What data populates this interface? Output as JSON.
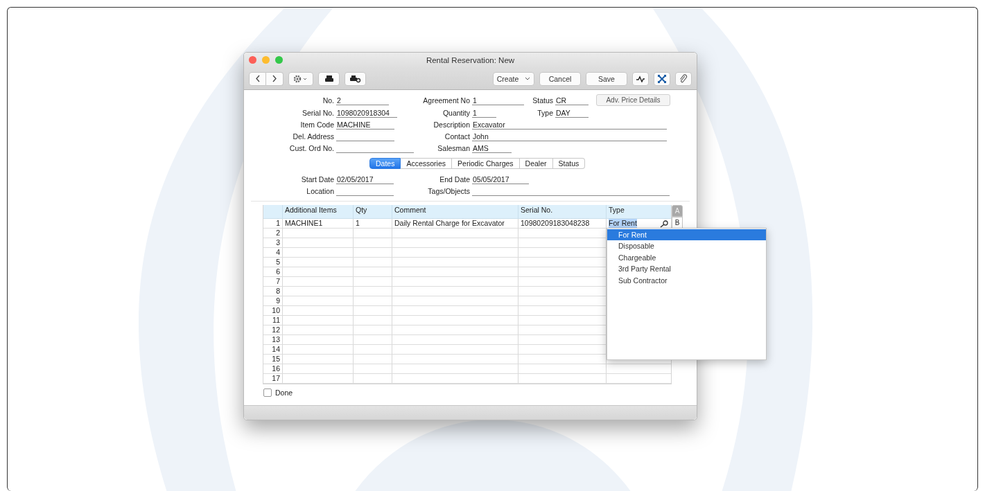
{
  "window": {
    "title": "Rental Reservation: New"
  },
  "toolbar": {
    "buttons": [
      {
        "kind": "create",
        "label": "Create"
      },
      {
        "kind": "plain",
        "label": "Cancel"
      },
      {
        "kind": "plain",
        "label": "Save"
      }
    ]
  },
  "form": {
    "rows": [
      [
        {
          "label": "No.",
          "value": "2"
        },
        {
          "label": "Agreement No",
          "value": "1"
        },
        {
          "label": "Status",
          "value": "CR"
        }
      ],
      [
        {
          "label": "Serial No.",
          "value": "1098020918304"
        },
        {
          "label": "Quantity",
          "value": "1"
        },
        {
          "label": "Type",
          "value": "DAY"
        }
      ],
      [
        {
          "label": "Item Code",
          "value": "MACHINE"
        },
        {
          "label": "Description",
          "value": "Excavator"
        }
      ],
      [
        {
          "label": "Del. Address"
        },
        {
          "label": "Contact",
          "value": "John"
        }
      ],
      [
        {
          "label": "Cust. Ord No."
        },
        {
          "label": "Salesman",
          "value": "AMS"
        }
      ]
    ],
    "side_button": "Adv. Price Details"
  },
  "tabs": [
    {
      "label": "Dates",
      "selected": true
    },
    {
      "label": "Accessories",
      "selected": false
    },
    {
      "label": "Periodic Charges",
      "selected": false
    },
    {
      "label": "Dealer",
      "selected": false
    },
    {
      "label": "Status",
      "selected": false
    }
  ],
  "dates": [
    [
      {
        "label": "Start Date",
        "value": "02/05/2017"
      },
      {
        "label": "End Date",
        "value": "05/05/2017"
      }
    ],
    [
      {
        "label": "Location"
      },
      {
        "label": "Tags/Objects"
      }
    ]
  ],
  "table": {
    "columns": [
      "Additional Items",
      "Qty",
      "Comment",
      "Serial No.",
      "Type"
    ],
    "rows": [
      {
        "number": "1",
        "cells": [
          "MACHINE1",
          "1",
          "Daily Rental Charge for Excavator",
          "10980209183048238",
          "For Rent"
        ]
      },
      {
        "number": "2"
      },
      {
        "number": "3"
      },
      {
        "number": "4"
      },
      {
        "number": "5"
      },
      {
        "number": "6"
      },
      {
        "number": "7"
      },
      {
        "number": "8"
      },
      {
        "number": "9"
      },
      {
        "number": "10"
      },
      {
        "number": "11"
      },
      {
        "number": "12"
      },
      {
        "number": "13"
      },
      {
        "number": "14"
      },
      {
        "number": "15"
      },
      {
        "number": "16"
      },
      {
        "number": "17"
      }
    ],
    "side_tabs": [
      {
        "label": "A",
        "selected": true
      },
      {
        "label": "B",
        "selected": false
      }
    ]
  },
  "dropdown": {
    "options": [
      {
        "label": "For Rent",
        "selected": true
      },
      {
        "label": "Disposable",
        "selected": false
      },
      {
        "label": "Chargeable",
        "selected": false
      },
      {
        "label": "3rd Party Rental",
        "selected": false
      },
      {
        "label": "Sub Contractor",
        "selected": false
      }
    ]
  },
  "done": {
    "label": "Done",
    "checked": false
  }
}
